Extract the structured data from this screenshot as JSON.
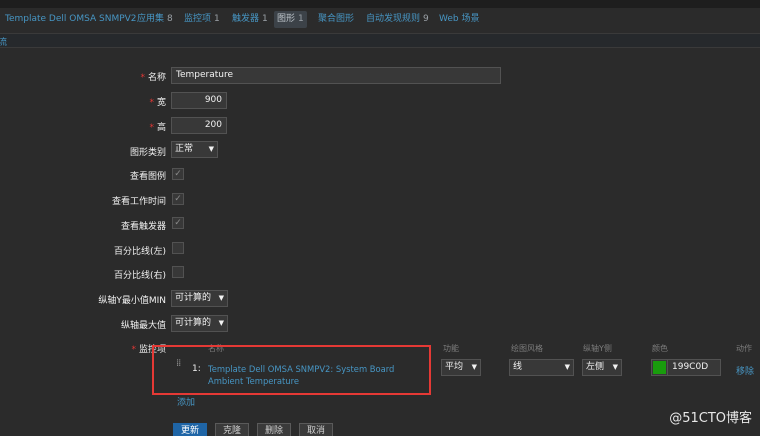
{
  "tabs": [
    {
      "label": "Template Dell OMSA SNMPV2",
      "count": ""
    },
    {
      "label": "应用集",
      "count": "8"
    },
    {
      "label": "监控项",
      "count": "1"
    },
    {
      "label": "触发器",
      "count": "1"
    },
    {
      "label": "图形",
      "count": "1"
    },
    {
      "label": "聚合图形",
      "count": ""
    },
    {
      "label": "自动发现规则",
      "count": "9"
    },
    {
      "label": "Web 场景",
      "count": ""
    }
  ],
  "subbar": {
    "text": "流"
  },
  "form": {
    "name_label": "名称",
    "name_value": "Temperature",
    "width_label": "宽",
    "width_value": "900",
    "height_label": "高",
    "height_value": "200",
    "graph_type_label": "图形类别",
    "graph_type_value": "正常",
    "show_legend_label": "查看图例",
    "show_working_time_label": "查看工作时间",
    "show_triggers_label": "查看触发器",
    "percentile_left_label": "百分比线(左)",
    "percentile_right_label": "百分比线(右)",
    "ymin_label": "纵轴Y最小值MIN",
    "ymin_value": "可计算的",
    "ymax_label": "纵轴最大值",
    "ymax_value": "可计算的",
    "items_label": "监控项"
  },
  "items_table": {
    "headers": {
      "name": "名称",
      "function": "功能",
      "draw_style": "绘图风格",
      "y_axis_side": "纵轴Y侧",
      "color": "颜色",
      "action": "动作"
    },
    "rows": [
      {
        "index": "1:",
        "name": "Template Dell OMSA SNMPV2: System Board Ambient Temperature",
        "function": "平均",
        "draw_style": "线",
        "y_axis_side": "左侧",
        "color_hex": "#199C0D",
        "color_text": "199C0D",
        "action": "移除"
      }
    ],
    "add_label": "添加"
  },
  "buttons": {
    "update": "更新",
    "clone": "克隆",
    "delete": "删除",
    "cancel": "取消"
  },
  "watermark": "@51CTO博客",
  "colors": {
    "background": "#2b2b2b",
    "link": "#4796c4",
    "required": "#e33734",
    "highlight_box": "#e53935",
    "primary_button": "#1f65a6"
  }
}
